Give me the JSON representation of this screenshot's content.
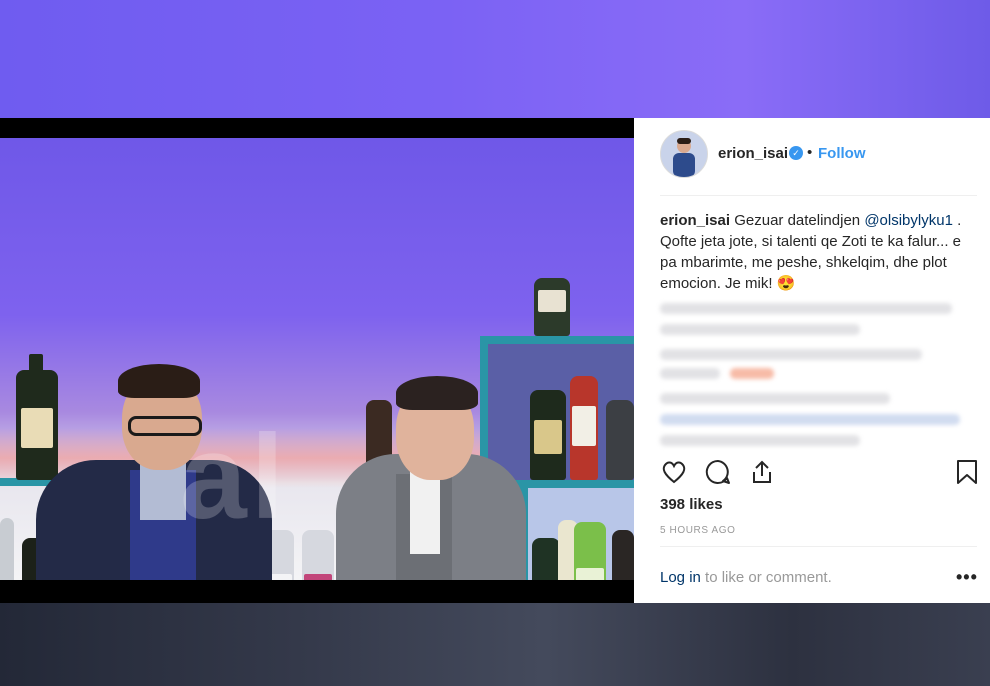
{
  "post": {
    "username": "erion_isai",
    "verified_icon": "verified-badge-icon",
    "dot": "•",
    "follow_label": "Follow",
    "caption": {
      "username": "erion_isai",
      "text_before": " Gezuar datelindjen ",
      "mention": "@olsibylyku1",
      "text_after": " . Qofte jeta jote, si talenti qe Zoti te ka falur... e pa mbarimte, me peshe, shkelqim, dhe plot emocion. Je mik! 😍"
    },
    "likes": "398 likes",
    "timestamp": "5 HOURS AGO",
    "login_link": "Log in",
    "login_suffix": " to like or comment.",
    "more_label": "•••",
    "actions": [
      "heart-icon",
      "comment-icon",
      "share-icon",
      "bookmark-icon"
    ]
  },
  "photo": {
    "watermark": "al"
  },
  "colors": {
    "link_blue": "#3897f0",
    "mention_blue": "#003569",
    "text": "#262626",
    "muted": "#999999"
  }
}
